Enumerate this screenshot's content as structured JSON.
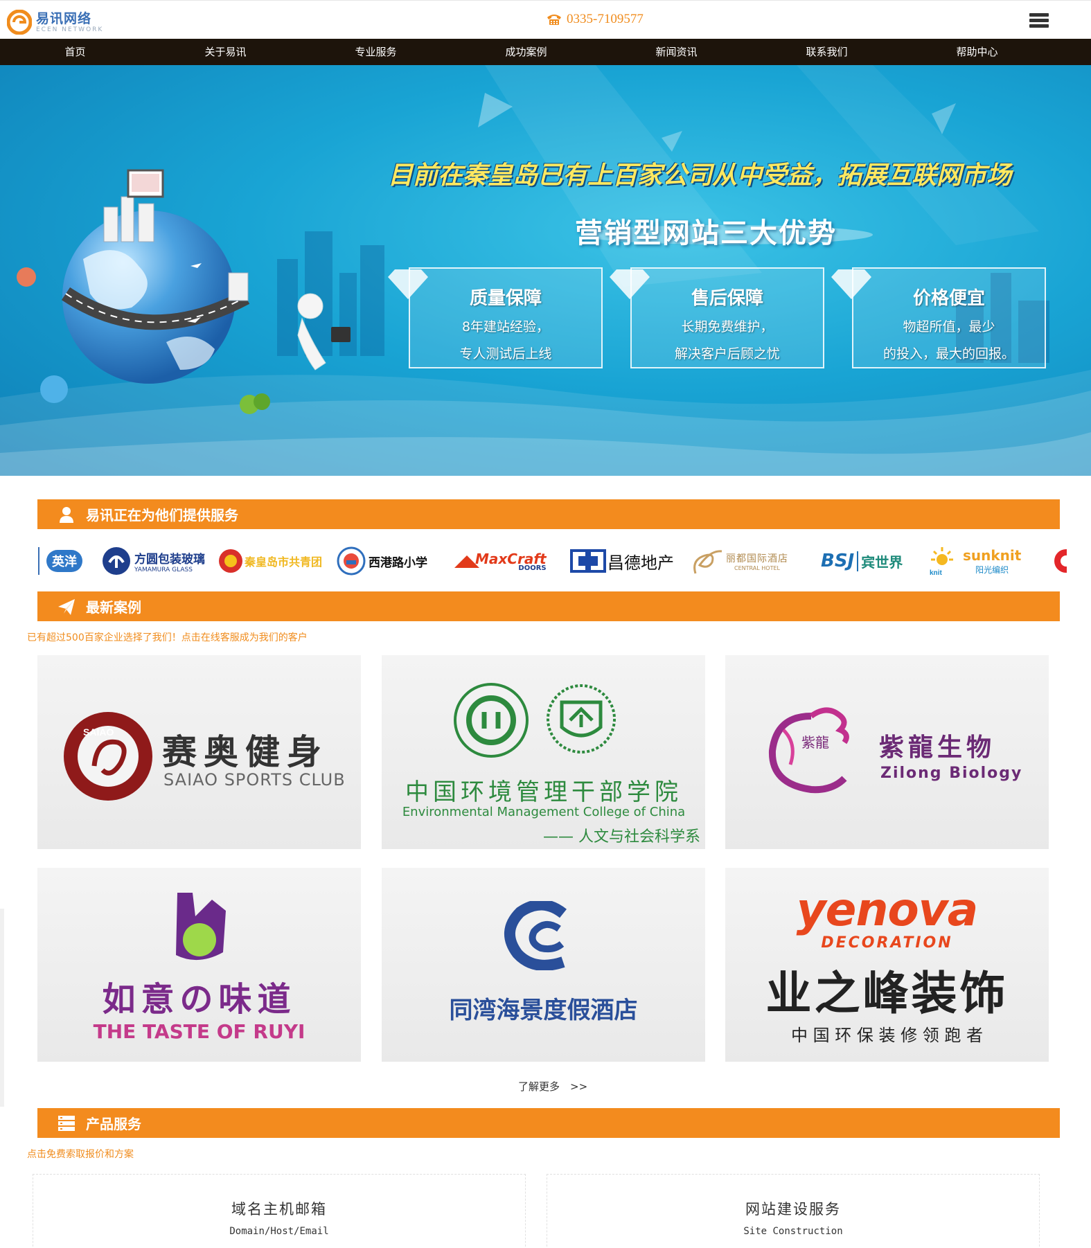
{
  "header": {
    "logo_cn": "易讯网络",
    "logo_en": "ECEN NETWORK",
    "phone": "0335-7109577"
  },
  "nav": {
    "items": [
      {
        "label": "首页"
      },
      {
        "label": "关于易讯"
      },
      {
        "label": "专业服务"
      },
      {
        "label": "成功案例"
      },
      {
        "label": "新闻资讯"
      },
      {
        "label": "联系我们"
      },
      {
        "label": "帮助中心"
      }
    ]
  },
  "banner": {
    "headline": "目前在秦皇岛已有上百家公司从中受益，拓展互联网市场",
    "subtitle": "营销型网站三大优势",
    "advantages": [
      {
        "title": "质量保障",
        "line1": "8年建站经验，",
        "line2": "专人测试后上线"
      },
      {
        "title": "售后保障",
        "line1": "长期免费维护，",
        "line2": "解决客户后顾之忧"
      },
      {
        "title": "价格便宜",
        "line1": "物超所值，最少",
        "line2": "的投入，最大的回报。"
      }
    ]
  },
  "clients": {
    "title": "易讯正在为他们提供服务",
    "logos": [
      {
        "name": "英洋"
      },
      {
        "name": "方圆包装玻璃",
        "sub": "YAMAMURA GLASS"
      },
      {
        "name": "秦皇岛市共青团"
      },
      {
        "name": "西港路小学"
      },
      {
        "name": "MaxCraft",
        "sub": "DOORS"
      },
      {
        "name": "昌德地产"
      },
      {
        "name": "丽都国际酒店",
        "sub": "CENTRAL HOTEL"
      },
      {
        "name": "BSJ",
        "sub": "宾世界"
      },
      {
        "name": "sunknit",
        "sub": "阳光编织"
      }
    ]
  },
  "cases": {
    "title": "最新案例",
    "hint": "已有超过500百家企业选择了我们！点击在线客服成为我们的客户",
    "items": [
      {
        "cn": "赛奥健身",
        "en": "SAIAO SPORTS CLUB"
      },
      {
        "cn": "中国环境管理干部学院",
        "en": "Environmental Management College of China",
        "extra": "—— 人文与社会科学系"
      },
      {
        "cn": "紫龍生物",
        "en": "Zilong Biology",
        "mark": "紫龍"
      },
      {
        "cn": "如意の味道",
        "en": "THE TASTE OF RUYI"
      },
      {
        "cn": "同湾海景度假酒店"
      },
      {
        "cn": "业之峰装饰",
        "en": "yenova",
        "en2": "DECORATION",
        "slogan": "中 国 环 保 装 修 领 跑 者"
      }
    ],
    "more": "了解更多　>>"
  },
  "products": {
    "title": "产品服务",
    "hint": "点击免费索取报价和方案",
    "items": [
      {
        "title": "域名主机邮箱",
        "sub": "Domain/Host/Email"
      },
      {
        "title": "网站建设服务",
        "sub": "Site Construction"
      }
    ]
  },
  "colors": {
    "accent": "#f38b1e",
    "nav_bg": "#1d140b",
    "banner_blue": "#19a4d4"
  }
}
